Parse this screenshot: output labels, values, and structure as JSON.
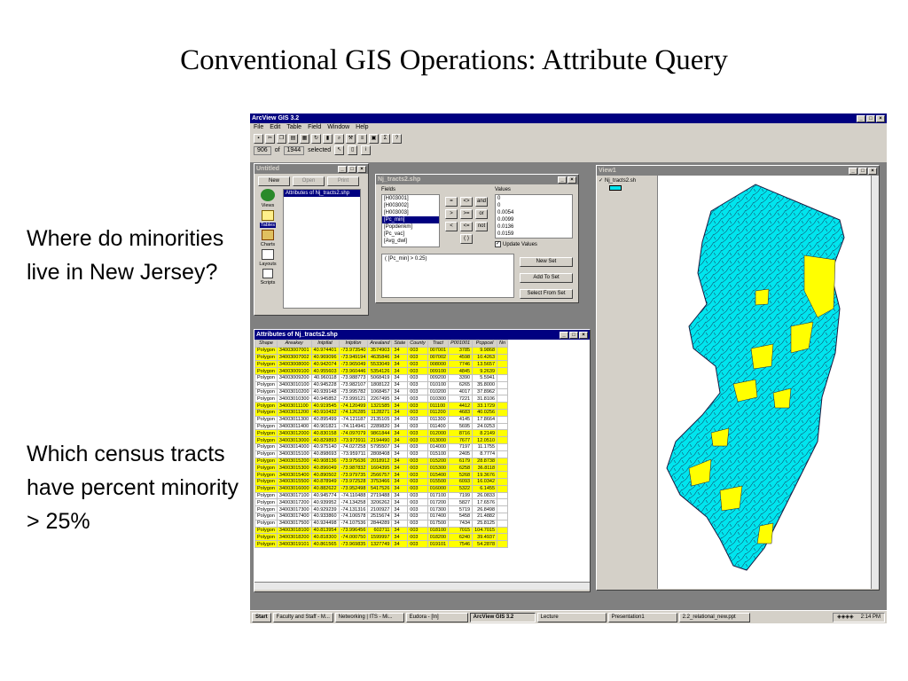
{
  "slide": {
    "title": "Conventional GIS Operations: Attribute Query",
    "question1": "Where do minorities live in New Jersey?",
    "question2": "Which census tracts have percent minority > 25%"
  },
  "app": {
    "title": "ArcView GIS 3.2",
    "menu": [
      "File",
      "Edit",
      "Table",
      "Field",
      "Window",
      "Help"
    ],
    "record_count": "906",
    "record_of": "of",
    "selected_count": "1944",
    "selected_label": "selected"
  },
  "untitled": {
    "title": "Untitled",
    "buttons": [
      "New",
      "Open",
      "Print"
    ],
    "list_item": "Attributes of Nj_tracts2.shp",
    "icons": [
      "Views",
      "Tables",
      "Charts",
      "Layouts",
      "Scripts"
    ]
  },
  "query": {
    "title": "Nj_tracts2.shp",
    "fields_label": "Fields",
    "fields": [
      "[H003001]",
      "[H003002]",
      "[H003003]",
      "[Pc_min]",
      "[Popdenkm]",
      "[Pc_vac]",
      "[Avg_dwl]"
    ],
    "selected_field": "[Pc_min]",
    "operators": [
      "=",
      "<>",
      "and",
      ">",
      ">=",
      "or",
      "<",
      "<=",
      "not",
      "( )"
    ],
    "values_label": "Values",
    "values": [
      "0",
      "0",
      "0.0054",
      "0.0099",
      "0.0136",
      "0.0159"
    ],
    "update_values": "Update Values",
    "expression": "( [Pc_min] > 0.25)",
    "new_set": "New Set",
    "add_to_set": "Add To Set",
    "select_from_set": "Select From Set"
  },
  "attributes": {
    "title": "Attributes of Nj_tracts2.shp",
    "columns": [
      "Shape",
      "Areakey",
      "Intptlat",
      "Intptlon",
      "Arealand",
      "State",
      "County",
      "Tract",
      "P001001",
      "Pcppcel",
      "Nn"
    ],
    "rows": [
      [
        "Polygon",
        "34003007001",
        "40.974401",
        "-73.973540",
        "3574903",
        "34",
        "003",
        "007001",
        "3785",
        "9.9868",
        true
      ],
      [
        "Polygon",
        "34003007002",
        "40.969096",
        "-73.949194",
        "4635846",
        "34",
        "003",
        "007002",
        "4598",
        "10.4263",
        true
      ],
      [
        "Polygon",
        "34003008000",
        "40.942074",
        "-73.965049",
        "5533049",
        "34",
        "003",
        "008000",
        "7746",
        "13.5657",
        true
      ],
      [
        "Polygon",
        "34003009100",
        "40.955603",
        "-73.960446",
        "5354126",
        "34",
        "003",
        "009100",
        "4845",
        "9.2639",
        true
      ],
      [
        "Polygon",
        "34003009200",
        "40.960118",
        "-73.988773",
        "5068419",
        "34",
        "003",
        "009200",
        "3390",
        "5.5941",
        false
      ],
      [
        "Polygon",
        "34003010100",
        "40.945228",
        "-73.982107",
        "1808122",
        "34",
        "003",
        "010100",
        "6265",
        "35.8000",
        false
      ],
      [
        "Polygon",
        "34003010200",
        "40.939148",
        "-73.995782",
        "1068457",
        "34",
        "003",
        "010200",
        "4017",
        "37.8962",
        false
      ],
      [
        "Polygon",
        "34003010300",
        "40.945852",
        "-73.999121",
        "2267495",
        "34",
        "003",
        "010300",
        "7221",
        "31.8106",
        false
      ],
      [
        "Polygon",
        "34003011100",
        "40.919545",
        "-74.120499",
        "1321585",
        "34",
        "003",
        "011100",
        "4412",
        "33.1729",
        true
      ],
      [
        "Polygon",
        "34003011200",
        "40.910432",
        "-74.126285",
        "1128271",
        "34",
        "003",
        "011200",
        "4683",
        "40.0256",
        true
      ],
      [
        "Polygon",
        "34003011300",
        "40.895499",
        "-74.121187",
        "2135105",
        "34",
        "003",
        "011300",
        "4145",
        "17.8664",
        false
      ],
      [
        "Polygon",
        "34003011400",
        "40.901821",
        "-74.114941",
        "2289820",
        "34",
        "003",
        "011400",
        "5695",
        "24.0253",
        false
      ],
      [
        "Polygon",
        "34003012000",
        "40.830158",
        "-74.097079",
        "9861844",
        "34",
        "003",
        "012000",
        "8716",
        "8.2149",
        true
      ],
      [
        "Polygon",
        "34003013000",
        "40.829893",
        "-73.973911",
        "2194490",
        "34",
        "003",
        "013000",
        "7677",
        "12.0510",
        true
      ],
      [
        "Polygon",
        "34003014000",
        "40.975140",
        "-74.027258",
        "5795507",
        "34",
        "003",
        "014000",
        "7197",
        "11.1755",
        false
      ],
      [
        "Polygon",
        "34003015100",
        "40.898693",
        "-73.959711",
        "2808408",
        "34",
        "003",
        "015100",
        "2405",
        "8.7774",
        false
      ],
      [
        "Polygon",
        "34003015200",
        "40.908136",
        "-73.975636",
        "2018912",
        "34",
        "003",
        "015200",
        "6179",
        "28.8738",
        true
      ],
      [
        "Polygon",
        "34003015300",
        "40.896049",
        "-73.987832",
        "1604395",
        "34",
        "003",
        "015300",
        "6258",
        "36.8118",
        true
      ],
      [
        "Polygon",
        "34003015400",
        "40.890502",
        "-73.979735",
        "2566757",
        "34",
        "003",
        "015400",
        "5268",
        "19.3676",
        true
      ],
      [
        "Polygon",
        "34003015500",
        "40.878949",
        "-73.972528",
        "3753466",
        "34",
        "003",
        "015500",
        "6093",
        "16.0342",
        true
      ],
      [
        "Polygon",
        "34003016000",
        "40.882622",
        "-73.952498",
        "5417526",
        "34",
        "003",
        "016000",
        "5322",
        "6.1455",
        true
      ],
      [
        "Polygon",
        "34003017100",
        "40.945774",
        "-74.110488",
        "2719488",
        "34",
        "003",
        "017100",
        "7199",
        "26.0833",
        false
      ],
      [
        "Polygon",
        "34003017200",
        "40.939952",
        "-74.134258",
        "3206262",
        "34",
        "003",
        "017200",
        "5827",
        "17.6576",
        false
      ],
      [
        "Polygon",
        "34003017300",
        "40.929239",
        "-74.131316",
        "2100927",
        "34",
        "003",
        "017300",
        "5719",
        "26.8498",
        false
      ],
      [
        "Polygon",
        "34003017400",
        "40.933860",
        "-74.106578",
        "2515674",
        "34",
        "003",
        "017400",
        "5458",
        "21.4882",
        false
      ],
      [
        "Polygon",
        "34003017500",
        "40.924498",
        "-74.107536",
        "2844289",
        "34",
        "003",
        "017500",
        "7434",
        "25.8125",
        false
      ],
      [
        "Polygon",
        "34003018100",
        "40.813954",
        "-73.996456",
        "602711",
        "34",
        "003",
        "018100",
        "7015",
        "104.7015",
        true
      ],
      [
        "Polygon",
        "34003018200",
        "40.818300",
        "-74.000750",
        "1599997",
        "34",
        "003",
        "018200",
        "6240",
        "39.4937",
        true
      ],
      [
        "Polygon",
        "34003019101",
        "40.861565",
        "-73.969835",
        "1327749",
        "34",
        "003",
        "019101",
        "7546",
        "54.2878",
        true
      ]
    ]
  },
  "view": {
    "title": "View1",
    "layer": "Nj_tracts2.sh",
    "colors": {
      "base": "#00e5ee",
      "selected": "#ffff00",
      "outline": "#1a1a40"
    }
  },
  "taskbar": {
    "start": "Start",
    "tasks": [
      "Faculty and Staff - M...",
      "Networking | ITS - Mi...",
      "Eudora - [In]",
      "ArcView GIS 3.2",
      "Lecture",
      "Presentation1",
      "2.2_relational_new.ppt"
    ],
    "active_task": 3,
    "clock": "2:14 PM"
  }
}
